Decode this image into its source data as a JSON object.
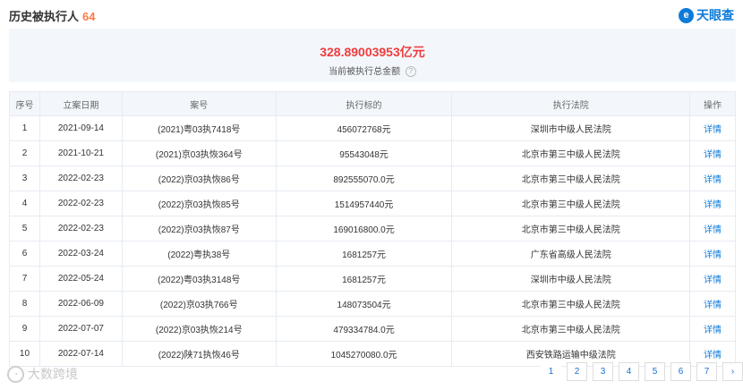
{
  "header": {
    "title": "历史被执行人",
    "count": "64",
    "brand": "天眼查",
    "brand_logo_char": "e"
  },
  "summary": {
    "amount": "328.89003953",
    "unit": "亿元",
    "label": "当前被执行总金额",
    "help": "?"
  },
  "table": {
    "columns": [
      "序号",
      "立案日期",
      "案号",
      "执行标的",
      "执行法院",
      "操作"
    ],
    "rows": [
      [
        "1",
        "2021-09-14",
        "(2021)粤03执7418号",
        "456072768元",
        "深圳市中级人民法院",
        "详情"
      ],
      [
        "2",
        "2021-10-21",
        "(2021)京03执恢364号",
        "95543048元",
        "北京市第三中级人民法院",
        "详情"
      ],
      [
        "3",
        "2022-02-23",
        "(2022)京03执恢86号",
        "892555070.0元",
        "北京市第三中级人民法院",
        "详情"
      ],
      [
        "4",
        "2022-02-23",
        "(2022)京03执恢85号",
        "1514957440元",
        "北京市第三中级人民法院",
        "详情"
      ],
      [
        "5",
        "2022-02-23",
        "(2022)京03执恢87号",
        "169016800.0元",
        "北京市第三中级人民法院",
        "详情"
      ],
      [
        "6",
        "2022-03-24",
        "(2022)粤执38号",
        "1681257元",
        "广东省高级人民法院",
        "详情"
      ],
      [
        "7",
        "2022-05-24",
        "(2022)粤03执3148号",
        "1681257元",
        "深圳市中级人民法院",
        "详情"
      ],
      [
        "8",
        "2022-06-09",
        "(2022)京03执766号",
        "148073504元",
        "北京市第三中级人民法院",
        "详情"
      ],
      [
        "9",
        "2022-07-07",
        "(2022)京03执恢214号",
        "479334784.0元",
        "北京市第三中级人民法院",
        "详情"
      ],
      [
        "10",
        "2022-07-14",
        "(2022)陕71执恢46号",
        "1045270080.0元",
        "西安铁路运输中级法院",
        "详情"
      ]
    ]
  },
  "pagination": {
    "pages": [
      "1",
      "2",
      "3",
      "4",
      "5",
      "6",
      "7"
    ],
    "current": "1",
    "next": "›"
  },
  "watermark": {
    "text": "大数跨境",
    "icon": "dashuju-logo-icon"
  },
  "colors": {
    "accent": "#0e7bd8",
    "amount": "#f03c3c",
    "count": "#ff7a45",
    "header_bg": "#f3f7fc"
  }
}
